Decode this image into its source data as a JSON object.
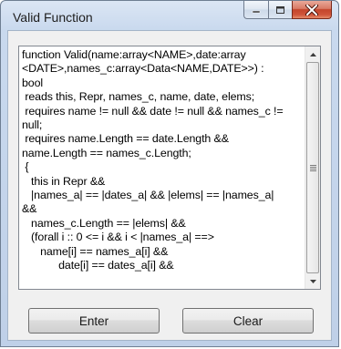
{
  "window": {
    "title": "Valid Function",
    "close_button_color": "#c4452b"
  },
  "caption_buttons": [
    {
      "name": "minimize-icon"
    },
    {
      "name": "maximize-icon"
    },
    {
      "name": "close-icon"
    }
  ],
  "editor": {
    "lines": [
      "function Valid(name:array<NAME>,date:array",
      "<DATE>,names_c:array<Data<NAME,DATE>>) :",
      "bool",
      " reads this, Repr, names_c, name, date, elems;",
      " requires name != null && date != null && names_c !=",
      "null;",
      " requires name.Length == date.Length &&",
      "name.Length == names_c.Length;",
      " {",
      "   this in Repr &&",
      "   |names_a| == |dates_a| && |elems| == |names_a|",
      "&&",
      "   names_c.Length == |elems| &&",
      "   (forall i :: 0 <= i && i < |names_a| ==>",
      "      name[i] == names_a[i] &&",
      "            date[i] == dates_a[i] &&"
    ],
    "scrollbar": {
      "up_icon": "scroll-up-arrow-icon",
      "down_icon": "scroll-down-arrow-icon",
      "thumb_position": 0.0
    }
  },
  "buttons": {
    "enter_label": "Enter",
    "clear_label": "Clear"
  }
}
